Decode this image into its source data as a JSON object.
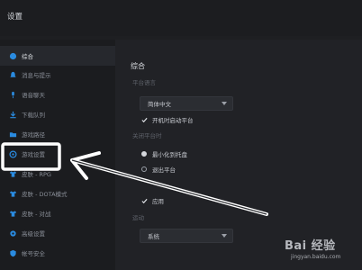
{
  "window": {
    "title": "设置"
  },
  "sidebar": {
    "items": [
      {
        "label": "综合",
        "icon": "settings-icon",
        "active": true
      },
      {
        "label": "消息与提示",
        "icon": "bell-icon"
      },
      {
        "label": "语音聊天",
        "icon": "mic-icon"
      },
      {
        "label": "下载队列",
        "icon": "download-icon"
      },
      {
        "label": "游戏路径",
        "icon": "folder-icon"
      },
      {
        "label": "游戏设置",
        "icon": "gamepad-icon"
      },
      {
        "label": "皮肤 - RPG",
        "icon": "shirt-icon"
      },
      {
        "label": "皮肤 - DOTA模式",
        "icon": "shirt-icon"
      },
      {
        "label": "皮肤 - 对战",
        "icon": "shirt-icon"
      },
      {
        "label": "高级设置",
        "icon": "gear-icon"
      },
      {
        "label": "帐号安全",
        "icon": "shield-icon"
      }
    ]
  },
  "main": {
    "section_title": "综合",
    "platform_language_label": "平台语言",
    "language_value": "简体中文",
    "autostart_label": "开机时启动平台",
    "close_behavior_label": "关闭平台时",
    "minimize_label": "最小化到托盘",
    "exit_label": "退出平台",
    "apply_label": "应用",
    "animation_label": "运动",
    "animation_value": "系统"
  },
  "colors": {
    "background": "#1e1f22",
    "sidebar_active": "#26282d",
    "annotation": "#ffffff"
  },
  "watermark": {
    "brand": "Bai 经验",
    "url": "jingyan.baidu.com"
  }
}
